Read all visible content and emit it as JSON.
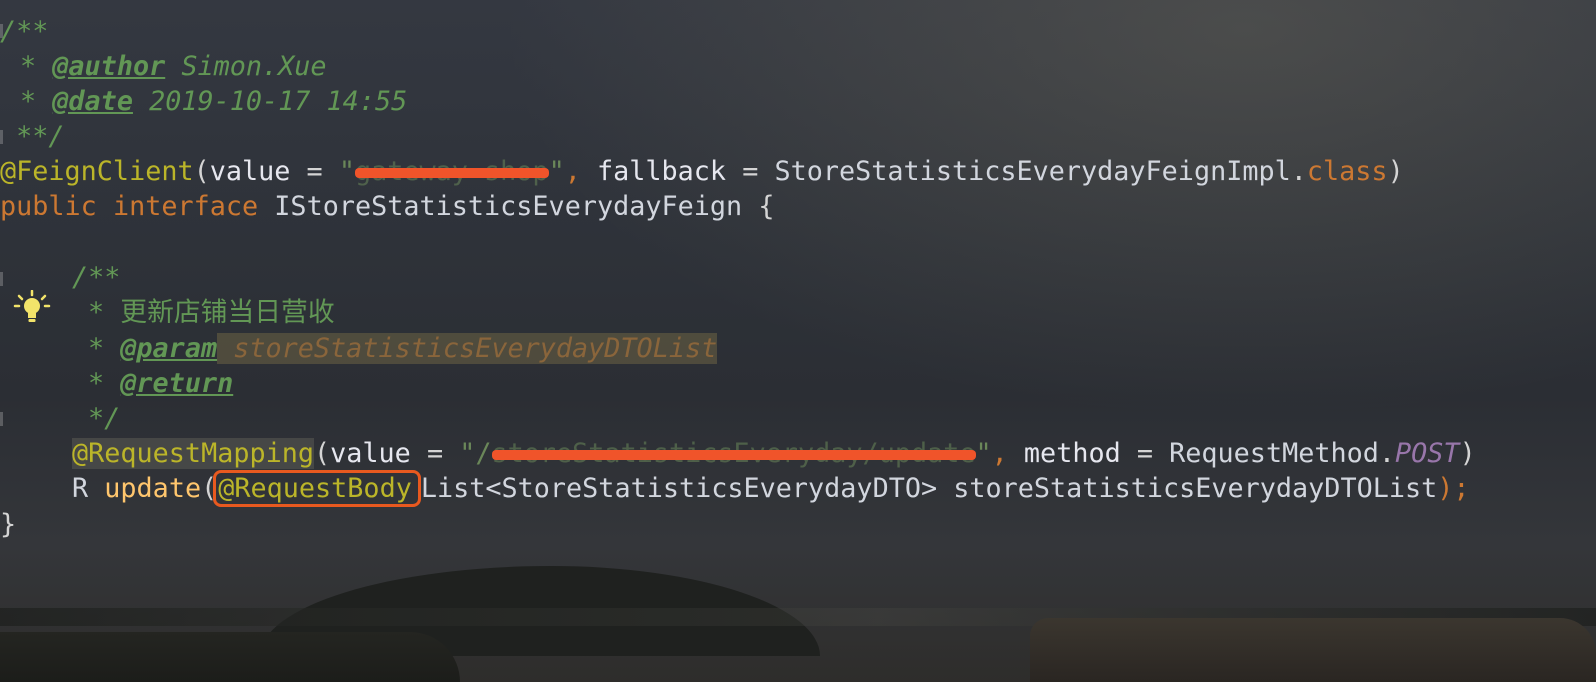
{
  "header_comment": {
    "open": "/**",
    "author_tag": "@author",
    "author": " Simon.Xue",
    "date_tag": "@date",
    "date": " 2019-10-17 14:55",
    "close": " **/"
  },
  "feign_client": {
    "annotation": "@FeignClient",
    "value_key": "value",
    "equals": " = ",
    "value_redacted": "gateway-shop",
    "fallback_key": "fallback",
    "fallback_class": "StoreStatisticsEverydayFeignImpl",
    "class_kw": "class"
  },
  "interface_decl": {
    "public_kw": "public",
    "interface_kw": "interface",
    "name": "IStoreStatisticsEverydayFeign",
    "brace_open": "{"
  },
  "method_doc": {
    "open": "/**",
    "description": "更新店铺当日营收",
    "param_tag": "@param",
    "param_name": "storeStatisticsEverydayDTOList",
    "return_tag": "@return",
    "close": "*/"
  },
  "request_mapping": {
    "annotation": "@RequestMapping",
    "value_key": "value",
    "path_prefix": "/",
    "path_redacted": "storeStatisticsEveryday/update",
    "method_key": "method",
    "request_method_class": "RequestMethod",
    "request_method_value": "POST"
  },
  "method_sig": {
    "return_type": "R",
    "name": "update",
    "param_annotation": "@RequestBody",
    "param_type": "List<StoreStatisticsEverydayDTO>",
    "param_name": "storeStatisticsEverydayDTOList",
    "end": ");"
  },
  "closing_brace": "}",
  "colors": {
    "comment": "#629755",
    "keyword": "#cc7832",
    "annotation": "#bbb529",
    "method": "#ffc66d",
    "highlight_box": "#e8591f",
    "redaction": "#f0542a",
    "static_field": "#9876aa"
  },
  "icons": {
    "intention_bulb": "lightbulb-icon"
  }
}
